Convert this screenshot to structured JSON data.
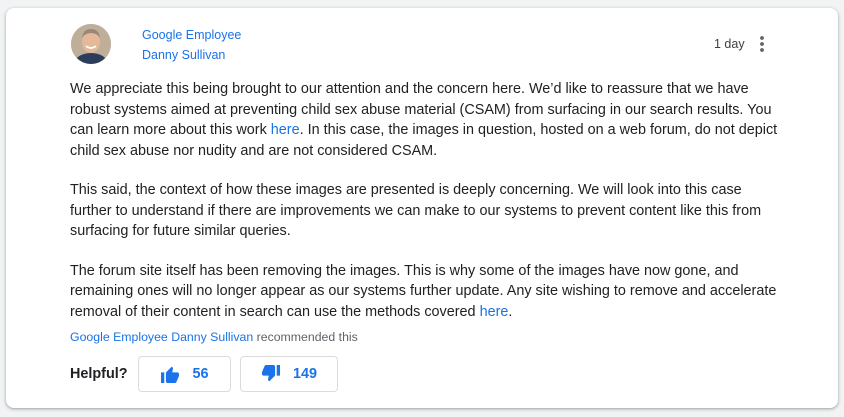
{
  "author": {
    "role": "Google Employee",
    "name": "Danny Sullivan"
  },
  "timestamp": "1 day",
  "icons": {
    "more": "more-vert-icon",
    "thumbs_up": "thumbs-up-icon",
    "thumbs_down": "thumbs-down-icon",
    "avatar": "avatar"
  },
  "colors": {
    "link": "#1a73e8",
    "text": "#202124",
    "muted": "#5f6368",
    "border": "#dadce0",
    "page_bg": "#f1f3f4"
  },
  "paragraphs": {
    "p1_before": "We appreciate this being brought to our attention and the concern here. We’d like to reassure that we have robust systems aimed at preventing child sex abuse material (CSAM) from surfacing in our search results. You can learn more about this work ",
    "p1_link": "here",
    "p1_after": ". In this case, the images in question, hosted on a web forum, do not depict child sex abuse nor nudity and are not considered CSAM.",
    "p2": "This said, the context of how these images are presented is deeply concerning. We will look into this case further to understand if there are improvements we can make to our systems to prevent content like this from surfacing for future similar queries.",
    "p3_before": "The forum site itself has been removing the images. This is why some of the images have now gone, and remaining ones will no longer appear as our systems further update. Any site wishing to remove and accelerate removal of their content in search can use the methods covered ",
    "p3_link": "here",
    "p3_after": "."
  },
  "recommended": {
    "role": "Google Employee",
    "name": "Danny Sullivan",
    "suffix": " recommended this"
  },
  "helpful": {
    "label": "Helpful?",
    "up_count": "56",
    "down_count": "149"
  }
}
